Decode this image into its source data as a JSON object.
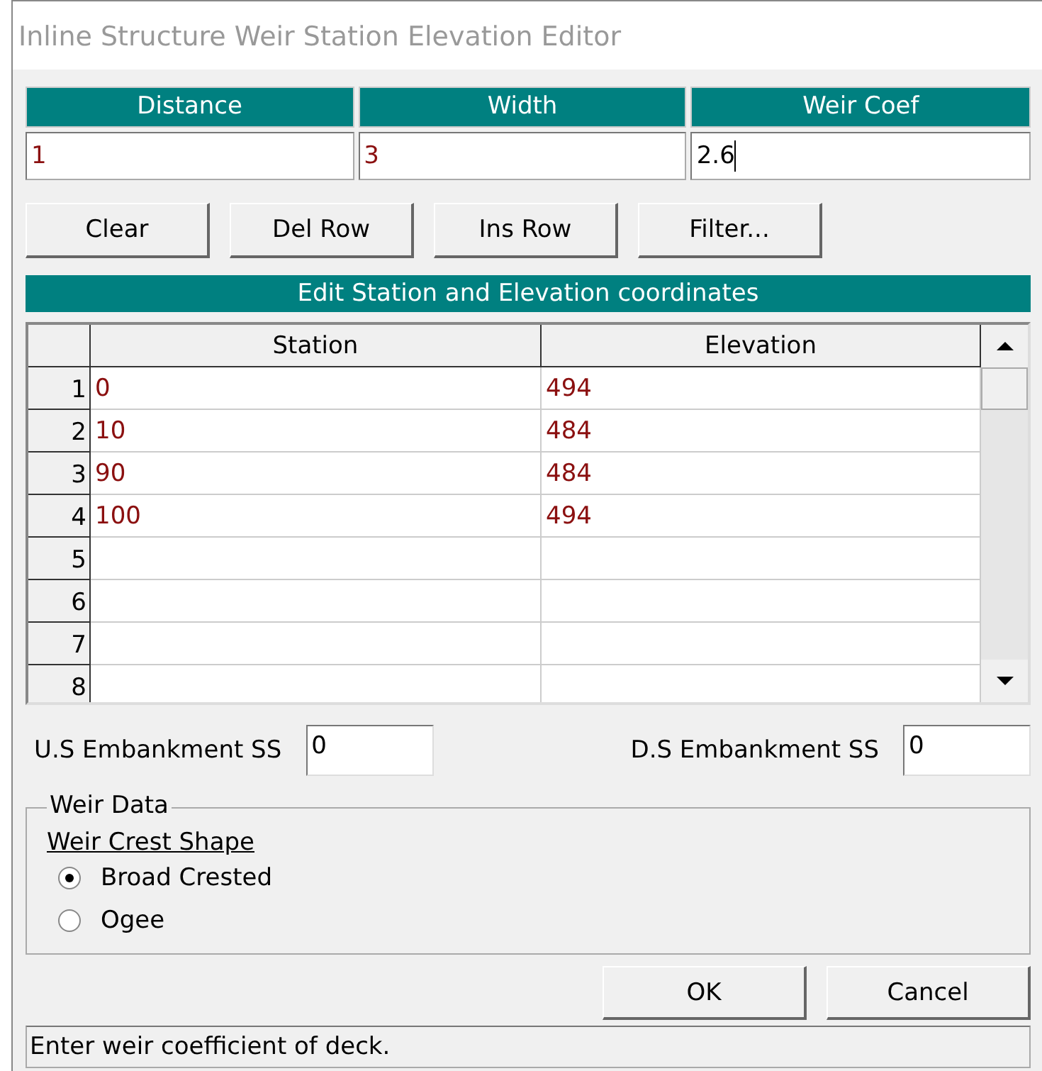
{
  "window": {
    "title": "Inline Structure Weir Station Elevation Editor"
  },
  "top_table": {
    "columns": [
      "Distance",
      "Width",
      "Weir Coef"
    ],
    "cells": [
      {
        "value": "1",
        "editing": false
      },
      {
        "value": "3",
        "editing": false
      },
      {
        "value": "2.6",
        "editing": true
      }
    ]
  },
  "buttons": [
    "Clear",
    "Del Row",
    "Ins Row",
    "Filter..."
  ],
  "grid": {
    "title": "Edit Station and Elevation coordinates",
    "columns": [
      "Station",
      "Elevation"
    ],
    "rows": [
      {
        "number": "1",
        "station": "0",
        "elevation": "494"
      },
      {
        "number": "2",
        "station": "10",
        "elevation": "484"
      },
      {
        "number": "3",
        "station": "90",
        "elevation": "484"
      },
      {
        "number": "4",
        "station": "100",
        "elevation": "494"
      },
      {
        "number": "5"
      },
      {
        "number": "6"
      },
      {
        "number": "7"
      },
      {
        "number": "8"
      }
    ]
  },
  "embankment": [
    {
      "label": "U.S Embankment SS",
      "value": "0"
    },
    {
      "label": "D.S Embankment SS",
      "value": "0"
    }
  ],
  "weir_data": {
    "title": "Weir Data",
    "subtitle": "Weir Crest Shape",
    "options": [
      {
        "label": "Broad Crested",
        "selected": true
      },
      {
        "label": "Ogee",
        "selected": false
      }
    ]
  },
  "dialog_buttons": [
    "OK",
    "Cancel"
  ],
  "status_bar": "Enter weir coefficient of deck."
}
